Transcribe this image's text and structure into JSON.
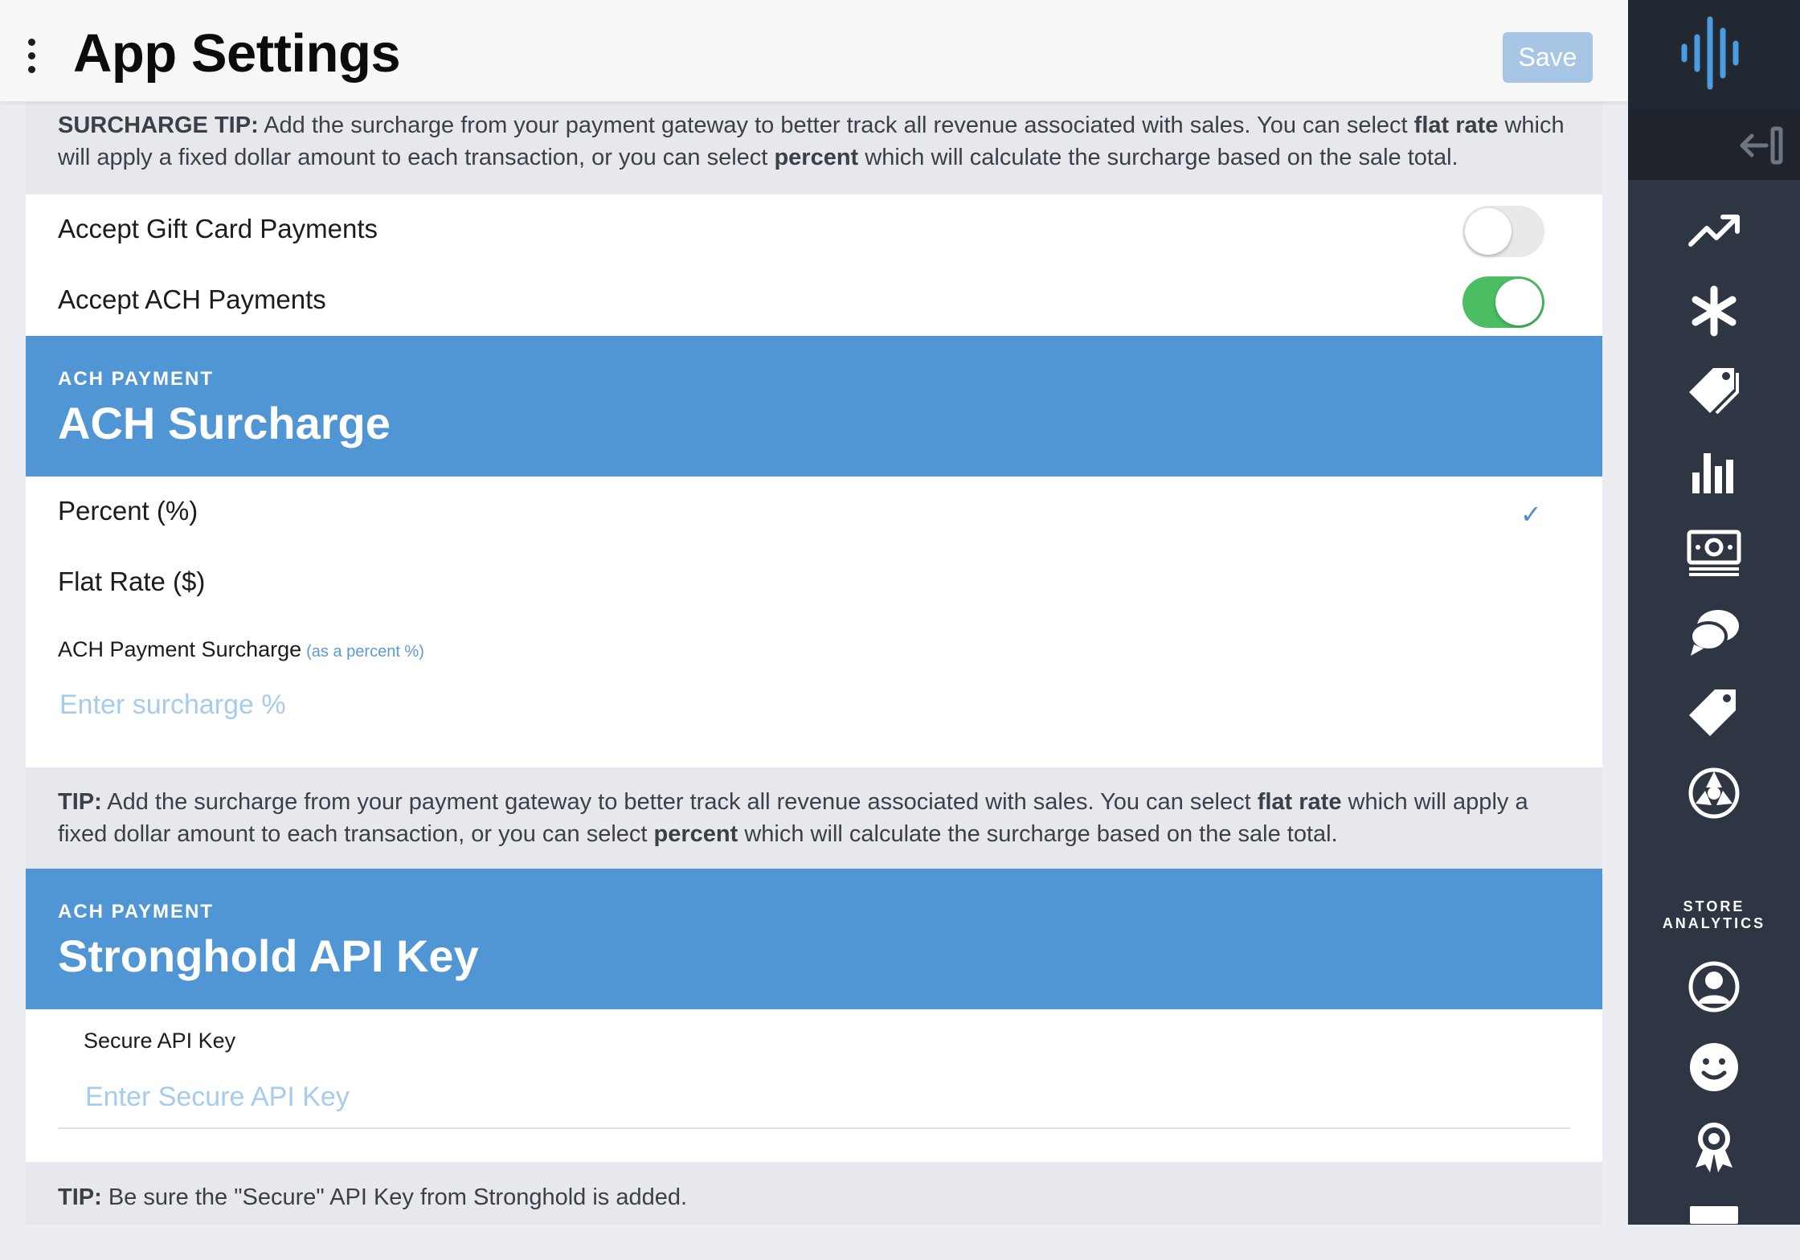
{
  "header": {
    "title": "App Settings",
    "save_label": "Save"
  },
  "surcharge_tip": {
    "lead": "SURCHARGE TIP:",
    "part1": " Add the surcharge from your payment gateway to better track all revenue associated with sales. You can select ",
    "bold1": "flat rate",
    "part2": " which will apply a fixed dollar amount to each transaction, or you can select ",
    "bold2": "percent",
    "part3": " which will calculate the surcharge based on the sale total."
  },
  "toggles": {
    "gift_card": {
      "label": "Accept Gift Card Payments",
      "state": "off"
    },
    "ach": {
      "label": "Accept ACH Payments",
      "state": "on"
    }
  },
  "ach_surcharge": {
    "kicker": "ACH PAYMENT",
    "title": "ACH Surcharge",
    "options": [
      {
        "label": "Percent (%)",
        "selected": true
      },
      {
        "label": "Flat Rate ($)",
        "selected": false
      }
    ],
    "check_glyph": "✓",
    "field_label": "ACH Payment Surcharge",
    "field_hint": "(as a percent %)",
    "field_placeholder": "Enter surcharge %"
  },
  "tip2": {
    "lead": "TIP:",
    "part1": " Add the surcharge from your payment gateway to better track all revenue associated with sales. You can select ",
    "bold1": "flat rate",
    "part2": " which will apply a fixed dollar amount to each transaction, or you can select ",
    "bold2": "percent",
    "part3": " which will calculate the surcharge based on the sale total."
  },
  "stronghold": {
    "kicker": "ACH PAYMENT",
    "title": "Stronghold API Key",
    "field_label": "Secure API Key",
    "field_placeholder": "Enter Secure API Key"
  },
  "tip3": {
    "lead": "TIP:",
    "text": " Be sure the \"Secure\" API Key from Stronghold is added."
  },
  "sidebar": {
    "section_label_line1": "STORE",
    "section_label_line2": "ANALYTICS",
    "icons": [
      "logo-icon",
      "collapse-icon",
      "trending-up-icon",
      "asterisk-icon",
      "tags-icon",
      "bar-chart-icon",
      "money-icon",
      "chat-icon",
      "tag-icon",
      "aperture-icon",
      "user-circle-icon",
      "smile-icon",
      "award-icon",
      "box-icon"
    ]
  },
  "colors": {
    "accent_blue": "#5196d4",
    "toggle_on": "#4bbd63",
    "sidebar_bg": "#2d3642",
    "save_button": "#a7c6e6"
  }
}
